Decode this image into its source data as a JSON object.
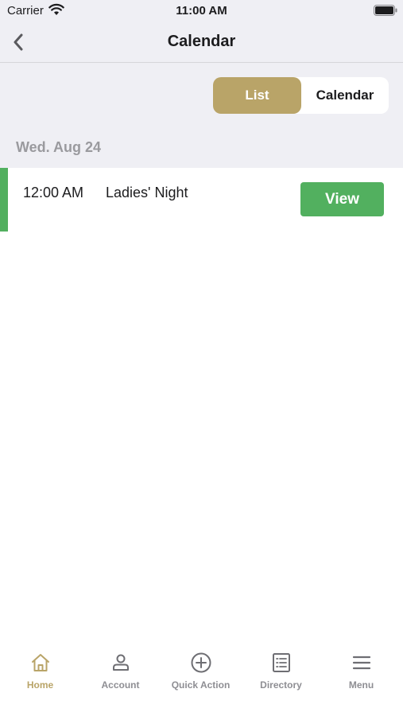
{
  "status_bar": {
    "carrier": "Carrier",
    "time": "11:00 AM",
    "icons": [
      "wifi-icon",
      "battery-icon"
    ]
  },
  "nav": {
    "title": "Calendar",
    "back_icon": "chevron-left-icon"
  },
  "view_toggle": {
    "options": [
      {
        "label": "List",
        "selected": true
      },
      {
        "label": "Calendar",
        "selected": false
      }
    ]
  },
  "events": {
    "date": "Wed. Aug 24",
    "items": [
      {
        "time": "12:00 AM",
        "title": "Ladies' Night",
        "action_label": "View"
      }
    ]
  },
  "tabs": [
    {
      "label": "Home",
      "icon": "home-icon",
      "active": true
    },
    {
      "label": "Account",
      "icon": "person-icon",
      "active": false
    },
    {
      "label": "Quick Action",
      "icon": "plus-circle-icon",
      "active": false
    },
    {
      "label": "Directory",
      "icon": "list-icon",
      "active": false
    },
    {
      "label": "Menu",
      "icon": "hamburger-menu-icon",
      "active": false
    }
  ],
  "colors": {
    "accent_gold": "#b9a468",
    "event_green": "#52b05f",
    "header_background": "#efeff4",
    "inactive_gray": "#8e8e93"
  }
}
